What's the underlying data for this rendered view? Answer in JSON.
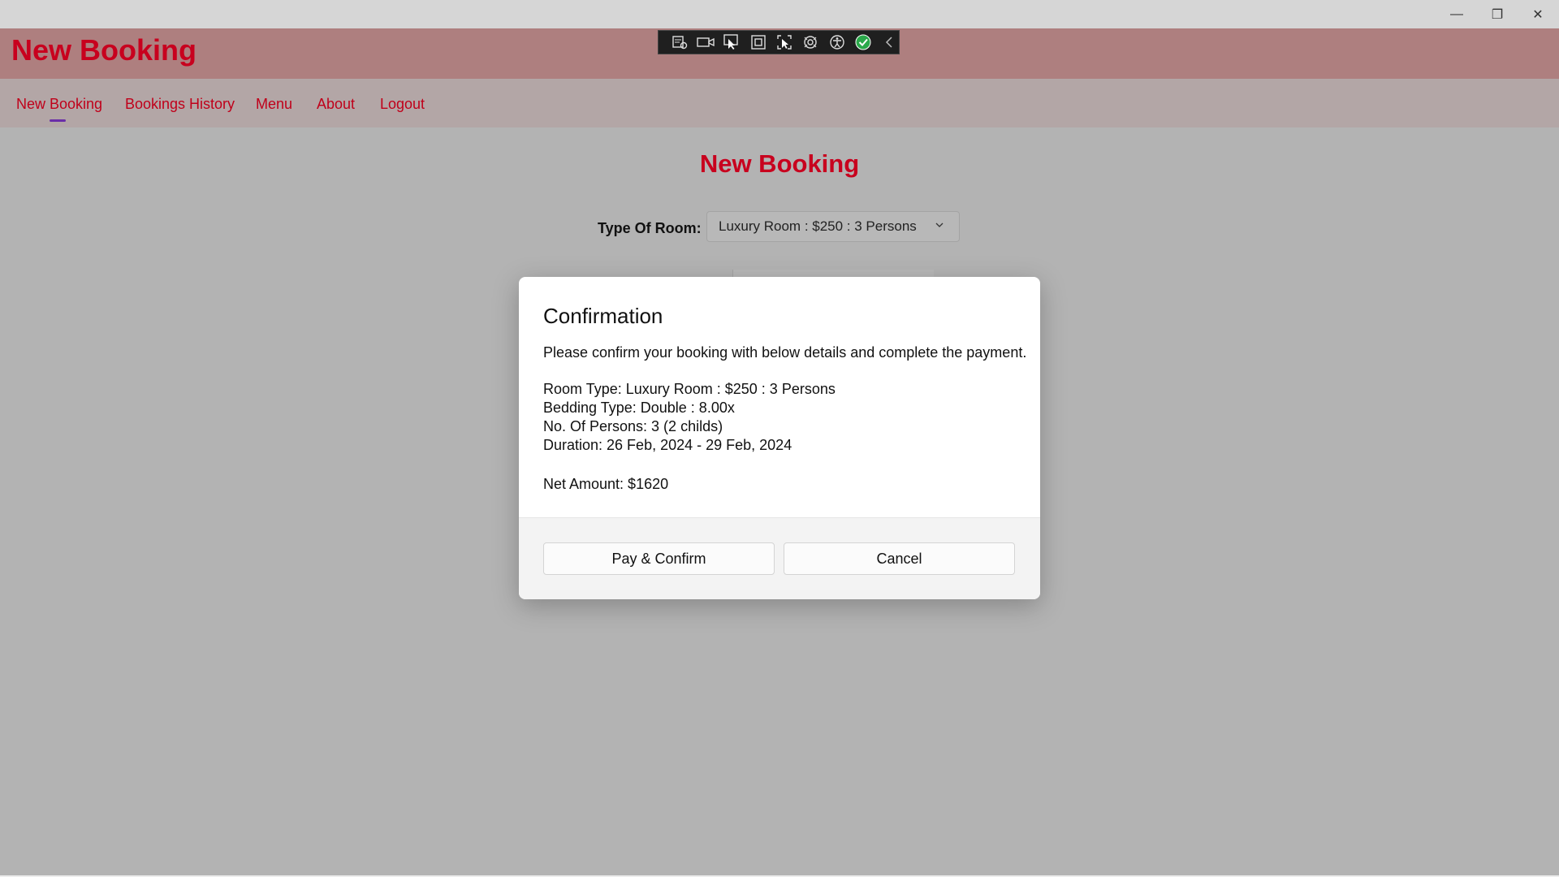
{
  "window": {
    "controls": {
      "minimize": "—",
      "maximize": "❐",
      "close": "✕"
    }
  },
  "header": {
    "title": "New Booking"
  },
  "debug_toolbar": {
    "icons": [
      "live-visual-tree-icon",
      "video-icon",
      "select-element-icon",
      "display-layout-icon",
      "track-focus-icon",
      "hot-reload-icon",
      "accessibility-icon",
      "check-icon",
      "collapse-chevron-icon"
    ],
    "accent": "#2aa84a"
  },
  "nav": {
    "items": [
      {
        "label": "New Booking",
        "active": true
      },
      {
        "label": "Bookings History"
      },
      {
        "label": "Menu"
      },
      {
        "label": "About"
      },
      {
        "label": "Logout"
      }
    ],
    "active_indicator_color": "#6a2ea8"
  },
  "page": {
    "title": "New Booking",
    "type_of_room_label": "Type Of Room:",
    "type_of_room_value": "Luxury Room : $250 : 3 Persons"
  },
  "dialog": {
    "title": "Confirmation",
    "message": "Please confirm your booking with below details and complete the payment.",
    "room_type": "Room Type: Luxury Room : $250 : 3 Persons",
    "bedding_type": "Bedding Type: Double : 8.00x",
    "persons": "No. Of Persons: 3 (2 childs)",
    "duration": "Duration: 26 Feb, 2024 - 29 Feb, 2024",
    "net_amount": "Net Amount: $1620",
    "primary_button": "Pay & Confirm",
    "secondary_button": "Cancel"
  },
  "colors": {
    "brand_red": "#c8001e",
    "header_bg": "#ae7f7f",
    "nav_bg": "#b3a6a6"
  }
}
